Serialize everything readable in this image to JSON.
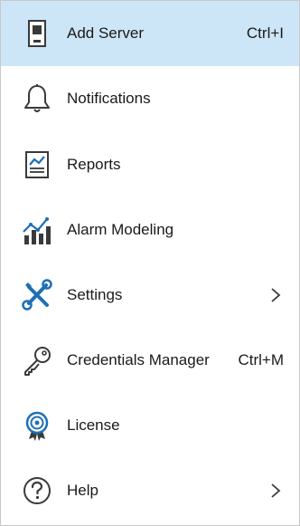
{
  "menu": {
    "items": [
      {
        "id": "add-server",
        "label": "Add Server",
        "shortcut": "Ctrl+I",
        "icon": "server-icon",
        "highlighted": true
      },
      {
        "id": "notifications",
        "label": "Notifications",
        "icon": "bell-icon"
      },
      {
        "id": "reports",
        "label": "Reports",
        "icon": "report-icon"
      },
      {
        "id": "alarm-modeling",
        "label": "Alarm Modeling",
        "icon": "chart-icon"
      },
      {
        "id": "settings",
        "label": "Settings",
        "icon": "wrench-screwdriver-icon",
        "submenu": true
      },
      {
        "id": "credentials-manager",
        "label": "Credentials Manager",
        "shortcut": "Ctrl+M",
        "icon": "key-icon"
      },
      {
        "id": "license",
        "label": "License",
        "icon": "badge-icon"
      },
      {
        "id": "help",
        "label": "Help",
        "icon": "help-circle-icon",
        "submenu": true
      }
    ]
  },
  "colors": {
    "highlight": "#cde6f7",
    "icon_dark": "#3a3a3a",
    "icon_blue": "#1e6fb5"
  }
}
